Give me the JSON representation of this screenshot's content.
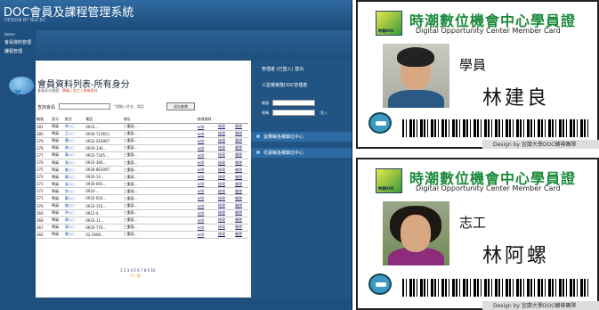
{
  "header": {
    "title": "DOC會員及課程管理系統",
    "subtitle": "DESIGN BY NUCDC"
  },
  "sidebar": {
    "home": "Home",
    "items": [
      "會員資料管理",
      "課程管理"
    ]
  },
  "main": {
    "title": "會員資料列表-所有身分",
    "subtitle_prefix": "會員身分篩選：",
    "subtitle_links": "學員 | 志工 | 所有身分",
    "search_label": "查詢會員",
    "search_value": "",
    "search_note": "*請輸入姓名、電話",
    "search_button": "送出查詢",
    "columns": [
      "編號",
      "身分",
      "姓名",
      "電話",
      "地址",
      "修改資料",
      "",
      ""
    ],
    "rows": [
      [
        "381",
        "學員",
        "李○○",
        "0933-..."
      ],
      [
        "380",
        "學員",
        "王○○",
        "0930-723651"
      ],
      [
        "379",
        "學員",
        "陳○○",
        "0932-264807"
      ],
      [
        "378",
        "學員",
        "林○○",
        "0930-136..."
      ],
      [
        "377",
        "學員",
        "黃○○",
        "0932-7345..."
      ],
      [
        "376",
        "學員",
        "張○○",
        "0931-366..."
      ],
      [
        "375",
        "學員",
        "劉○○",
        "0930-863097"
      ],
      [
        "374",
        "學員",
        "楊○○",
        "0932-14..."
      ],
      [
        "373",
        "學員",
        "吳○○",
        "0930-665..."
      ],
      [
        "372",
        "學員",
        "許○○",
        "0932-..."
      ],
      [
        "371",
        "學員",
        "鄭○○",
        "0932-054..."
      ],
      [
        "370",
        "學員",
        "謝○○",
        "0933-154..."
      ],
      [
        "369",
        "學員",
        "洪○○",
        "0912-4..."
      ],
      [
        "368",
        "學員",
        "郭○○",
        "0932-11..."
      ],
      [
        "367",
        "學員",
        "邱○○",
        "0935-776..."
      ],
      [
        "366",
        "學員",
        "曾○○",
        "02-2608..."
      ]
    ],
    "row_address": "三重區...",
    "row_actions": [
      "edit",
      "修改",
      "刪除"
    ],
    "pager": "1 2 3 4 5 6 7 8 9 10",
    "pager_next": "下一頁"
  },
  "right": {
    "user_title": "管理者 (已登入) 登出",
    "center_title": "三星鄉東隆DOC管理者",
    "account_label": "帳號",
    "password_label": "密碼",
    "login_go": "登入",
    "bars": [
      "宜蘭縣各鄉鎮位中心",
      "花蓮縣各鄉鎮位中心"
    ]
  },
  "cards": [
    {
      "title": "時潮數位機會中心學員證",
      "subtitle": "Digital Opportunity Center Member Card",
      "role": "學員",
      "name": "林建良",
      "logo_text": "時潮DOC",
      "footer": "Design by 宜蘭大學DOC輔導團隊"
    },
    {
      "title": "時潮數位機會中心學員證",
      "subtitle": "Digital Opportunity Center Member Card",
      "role": "志工",
      "name": "林阿螺",
      "logo_text": "時潮DOC",
      "footer": "Design by 宜蘭大學DOC輔導團隊"
    }
  ]
}
